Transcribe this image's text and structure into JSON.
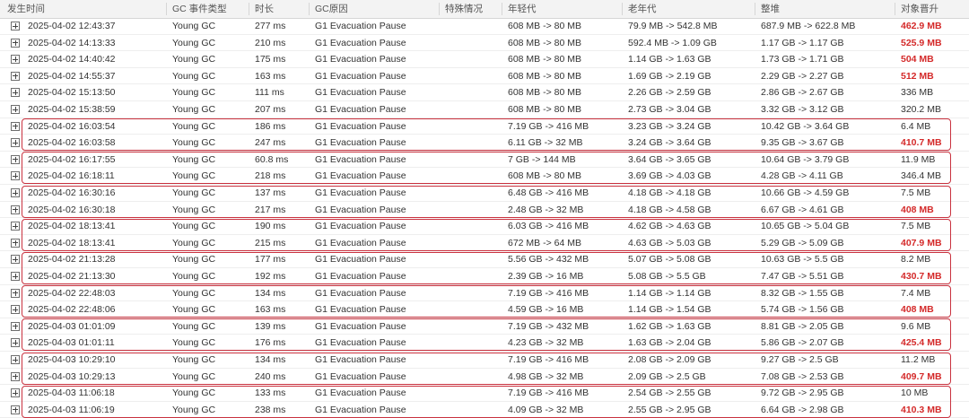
{
  "columns": [
    "发生时间",
    "GC 事件类型",
    "时长",
    "GC原因",
    "特殊情况",
    "年轻代",
    "老年代",
    "整堆",
    "对象晋升"
  ],
  "highlight_color": "#d42a2a",
  "group_border_color": "#c9323f",
  "rows": [
    {
      "time": "2025-04-02 12:43:37",
      "type": "Young GC",
      "duration": "277 ms",
      "cause": "G1 Evacuation Pause",
      "special": "",
      "young": "608 MB -> 80 MB",
      "old": "79.9 MB -> 542.8 MB",
      "heap": "687.9 MB -> 622.8 MB",
      "promotion": "462.9 MB",
      "promotion_highlight": true
    },
    {
      "time": "2025-04-02 14:13:33",
      "type": "Young GC",
      "duration": "210 ms",
      "cause": "G1 Evacuation Pause",
      "special": "",
      "young": "608 MB -> 80 MB",
      "old": "592.4 MB -> 1.09 GB",
      "heap": "1.17 GB -> 1.17 GB",
      "promotion": "525.9 MB",
      "promotion_highlight": true
    },
    {
      "time": "2025-04-02 14:40:42",
      "type": "Young GC",
      "duration": "175 ms",
      "cause": "G1 Evacuation Pause",
      "special": "",
      "young": "608 MB -> 80 MB",
      "old": "1.14 GB -> 1.63 GB",
      "heap": "1.73 GB -> 1.71 GB",
      "promotion": "504 MB",
      "promotion_highlight": true
    },
    {
      "time": "2025-04-02 14:55:37",
      "type": "Young GC",
      "duration": "163 ms",
      "cause": "G1 Evacuation Pause",
      "special": "",
      "young": "608 MB -> 80 MB",
      "old": "1.69 GB -> 2.19 GB",
      "heap": "2.29 GB -> 2.27 GB",
      "promotion": "512 MB",
      "promotion_highlight": true
    },
    {
      "time": "2025-04-02 15:13:50",
      "type": "Young GC",
      "duration": "111 ms",
      "cause": "G1 Evacuation Pause",
      "special": "",
      "young": "608 MB -> 80 MB",
      "old": "2.26 GB -> 2.59 GB",
      "heap": "2.86 GB -> 2.67 GB",
      "promotion": "336 MB",
      "promotion_highlight": false
    },
    {
      "time": "2025-04-02 15:38:59",
      "type": "Young GC",
      "duration": "207 ms",
      "cause": "G1 Evacuation Pause",
      "special": "",
      "young": "608 MB -> 80 MB",
      "old": "2.73 GB -> 3.04 GB",
      "heap": "3.32 GB -> 3.12 GB",
      "promotion": "320.2 MB",
      "promotion_highlight": false
    },
    {
      "time": "2025-04-02 16:03:54",
      "type": "Young GC",
      "duration": "186 ms",
      "cause": "G1 Evacuation Pause",
      "special": "",
      "young": "7.19 GB -> 416 MB",
      "old": "3.23 GB -> 3.24 GB",
      "heap": "10.42 GB -> 3.64 GB",
      "promotion": "6.4 MB",
      "promotion_highlight": false
    },
    {
      "time": "2025-04-02 16:03:58",
      "type": "Young GC",
      "duration": "247 ms",
      "cause": "G1 Evacuation Pause",
      "special": "",
      "young": "6.11 GB -> 32 MB",
      "old": "3.24 GB -> 3.64 GB",
      "heap": "9.35 GB -> 3.67 GB",
      "promotion": "410.7 MB",
      "promotion_highlight": true
    },
    {
      "time": "2025-04-02 16:17:55",
      "type": "Young GC",
      "duration": "60.8 ms",
      "cause": "G1 Evacuation Pause",
      "special": "",
      "young": "7 GB -> 144 MB",
      "old": "3.64 GB -> 3.65 GB",
      "heap": "10.64 GB -> 3.79 GB",
      "promotion": "11.9 MB",
      "promotion_highlight": false
    },
    {
      "time": "2025-04-02 16:18:11",
      "type": "Young GC",
      "duration": "218 ms",
      "cause": "G1 Evacuation Pause",
      "special": "",
      "young": "608 MB -> 80 MB",
      "old": "3.69 GB -> 4.03 GB",
      "heap": "4.28 GB -> 4.11 GB",
      "promotion": "346.4 MB",
      "promotion_highlight": false
    },
    {
      "time": "2025-04-02 16:30:16",
      "type": "Young GC",
      "duration": "137 ms",
      "cause": "G1 Evacuation Pause",
      "special": "",
      "young": "6.48 GB -> 416 MB",
      "old": "4.18 GB -> 4.18 GB",
      "heap": "10.66 GB -> 4.59 GB",
      "promotion": "7.5 MB",
      "promotion_highlight": false
    },
    {
      "time": "2025-04-02 16:30:18",
      "type": "Young GC",
      "duration": "217 ms",
      "cause": "G1 Evacuation Pause",
      "special": "",
      "young": "2.48 GB -> 32 MB",
      "old": "4.18 GB -> 4.58 GB",
      "heap": "6.67 GB -> 4.61 GB",
      "promotion": "408 MB",
      "promotion_highlight": true
    },
    {
      "time": "2025-04-02 18:13:41",
      "type": "Young GC",
      "duration": "190 ms",
      "cause": "G1 Evacuation Pause",
      "special": "",
      "young": "6.03 GB -> 416 MB",
      "old": "4.62 GB -> 4.63 GB",
      "heap": "10.65 GB -> 5.04 GB",
      "promotion": "7.5 MB",
      "promotion_highlight": false
    },
    {
      "time": "2025-04-02 18:13:41",
      "type": "Young GC",
      "duration": "215 ms",
      "cause": "G1 Evacuation Pause",
      "special": "",
      "young": "672 MB -> 64 MB",
      "old": "4.63 GB -> 5.03 GB",
      "heap": "5.29 GB -> 5.09 GB",
      "promotion": "407.9 MB",
      "promotion_highlight": true
    },
    {
      "time": "2025-04-02 21:13:28",
      "type": "Young GC",
      "duration": "177 ms",
      "cause": "G1 Evacuation Pause",
      "special": "",
      "young": "5.56 GB -> 432 MB",
      "old": "5.07 GB -> 5.08 GB",
      "heap": "10.63 GB -> 5.5 GB",
      "promotion": "8.2 MB",
      "promotion_highlight": false
    },
    {
      "time": "2025-04-02 21:13:30",
      "type": "Young GC",
      "duration": "192 ms",
      "cause": "G1 Evacuation Pause",
      "special": "",
      "young": "2.39 GB -> 16 MB",
      "old": "5.08 GB -> 5.5 GB",
      "heap": "7.47 GB -> 5.51 GB",
      "promotion": "430.7 MB",
      "promotion_highlight": true
    },
    {
      "time": "2025-04-02 22:48:03",
      "type": "Young GC",
      "duration": "134 ms",
      "cause": "G1 Evacuation Pause",
      "special": "",
      "young": "7.19 GB -> 416 MB",
      "old": "1.14 GB -> 1.14 GB",
      "heap": "8.32 GB -> 1.55 GB",
      "promotion": "7.4 MB",
      "promotion_highlight": false
    },
    {
      "time": "2025-04-02 22:48:06",
      "type": "Young GC",
      "duration": "163 ms",
      "cause": "G1 Evacuation Pause",
      "special": "",
      "young": "4.59 GB -> 16 MB",
      "old": "1.14 GB -> 1.54 GB",
      "heap": "5.74 GB -> 1.56 GB",
      "promotion": "408 MB",
      "promotion_highlight": true
    },
    {
      "time": "2025-04-03 01:01:09",
      "type": "Young GC",
      "duration": "139 ms",
      "cause": "G1 Evacuation Pause",
      "special": "",
      "young": "7.19 GB -> 432 MB",
      "old": "1.62 GB -> 1.63 GB",
      "heap": "8.81 GB -> 2.05 GB",
      "promotion": "9.6 MB",
      "promotion_highlight": false
    },
    {
      "time": "2025-04-03 01:01:11",
      "type": "Young GC",
      "duration": "176 ms",
      "cause": "G1 Evacuation Pause",
      "special": "",
      "young": "4.23 GB -> 32 MB",
      "old": "1.63 GB -> 2.04 GB",
      "heap": "5.86 GB -> 2.07 GB",
      "promotion": "425.4 MB",
      "promotion_highlight": true
    },
    {
      "time": "2025-04-03 10:29:10",
      "type": "Young GC",
      "duration": "134 ms",
      "cause": "G1 Evacuation Pause",
      "special": "",
      "young": "7.19 GB -> 416 MB",
      "old": "2.08 GB -> 2.09 GB",
      "heap": "9.27 GB -> 2.5 GB",
      "promotion": "11.2 MB",
      "promotion_highlight": false
    },
    {
      "time": "2025-04-03 10:29:13",
      "type": "Young GC",
      "duration": "240 ms",
      "cause": "G1 Evacuation Pause",
      "special": "",
      "young": "4.98 GB -> 32 MB",
      "old": "2.09 GB -> 2.5 GB",
      "heap": "7.08 GB -> 2.53 GB",
      "promotion": "409.7 MB",
      "promotion_highlight": true
    },
    {
      "time": "2025-04-03 11:06:18",
      "type": "Young GC",
      "duration": "133 ms",
      "cause": "G1 Evacuation Pause",
      "special": "",
      "young": "7.19 GB -> 416 MB",
      "old": "2.54 GB -> 2.55 GB",
      "heap": "9.72 GB -> 2.95 GB",
      "promotion": "10 MB",
      "promotion_highlight": false
    },
    {
      "time": "2025-04-03 11:06:19",
      "type": "Young GC",
      "duration": "238 ms",
      "cause": "G1 Evacuation Pause",
      "special": "",
      "young": "4.09 GB -> 32 MB",
      "old": "2.55 GB -> 2.95 GB",
      "heap": "6.64 GB -> 2.98 GB",
      "promotion": "410.3 MB",
      "promotion_highlight": true
    }
  ],
  "highlighted_groups": [
    [
      6,
      7
    ],
    [
      8,
      9
    ],
    [
      10,
      11
    ],
    [
      12,
      13
    ],
    [
      14,
      15
    ],
    [
      16,
      17
    ],
    [
      18,
      19
    ],
    [
      20,
      21
    ],
    [
      22,
      23
    ]
  ]
}
